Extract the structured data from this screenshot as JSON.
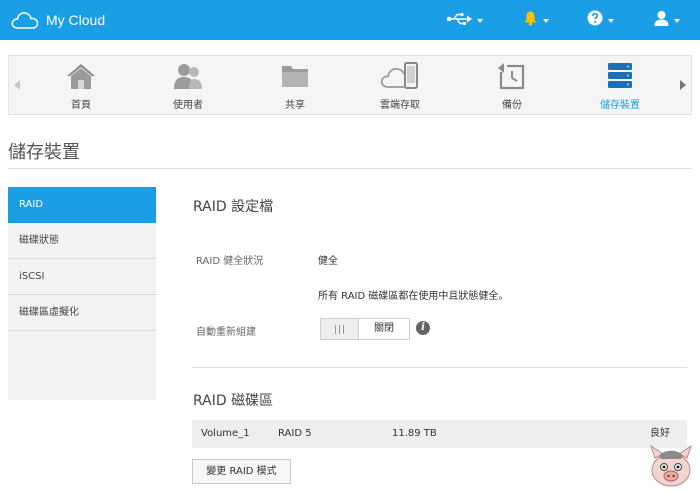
{
  "app": {
    "title": "My Cloud"
  },
  "topbar": {
    "usb_icon": "usb-icon",
    "alert_icon": "bell-icon",
    "help_icon": "help-icon",
    "user_icon": "user-icon",
    "brand_color": "#1a9ee6"
  },
  "nav": {
    "items": [
      {
        "label": "首頁",
        "icon": "home-icon"
      },
      {
        "label": "使用者",
        "icon": "users-icon"
      },
      {
        "label": "共享",
        "icon": "folder-icon"
      },
      {
        "label": "雲端存取",
        "icon": "cloud-device-icon"
      },
      {
        "label": "備份",
        "icon": "backup-icon"
      },
      {
        "label": "儲存裝置",
        "icon": "storage-icon",
        "active": true
      }
    ]
  },
  "page": {
    "title": "儲存裝置"
  },
  "sidebar": {
    "items": [
      {
        "label": "RAID",
        "active": true
      },
      {
        "label": "磁碟狀態"
      },
      {
        "label": "iSCSI"
      },
      {
        "label": "磁碟區虛擬化"
      }
    ]
  },
  "raid_profile": {
    "title": "RAID 設定檔",
    "health_label": "RAID 健全狀況",
    "health_value": "健全",
    "health_detail": "所有 RAID 磁碟區都在使用中且狀態健全。",
    "auto_rebuild_label": "自動重新組建",
    "auto_rebuild_value": "關閉"
  },
  "raid_volumes": {
    "title": "RAID 磁碟區",
    "rows": [
      {
        "name": "Volume_1",
        "raid": "RAID 5",
        "size": "11.89 TB",
        "status": "良好"
      }
    ],
    "change_button": "變更 RAID 模式"
  }
}
